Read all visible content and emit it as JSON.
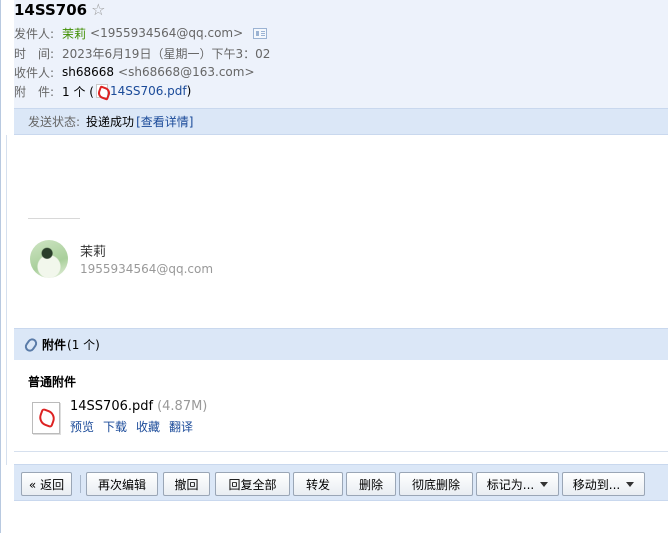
{
  "email": {
    "subject": "14SS706",
    "star": "☆",
    "from_label": "发件人:",
    "from_name": "茉莉",
    "from_addr": "<1955934564@qq.com>",
    "time_label": "时　间:",
    "time_value": "2023年6月19日（星期一）下午3：02",
    "to_label": "收件人:",
    "to_name": "sh68668",
    "to_addr": "<sh68668@163.com>",
    "attach_label": "附　件:",
    "attach_count": "1 个 (",
    "attach_file": "14SS706.pdf",
    "attach_close": ")",
    "status_label": "发送状态:",
    "status_value": "投递成功",
    "status_link": "[查看详情]"
  },
  "signature": {
    "name": "茉莉",
    "email": "1955934564@qq.com"
  },
  "attachments": {
    "title": "附件",
    "count": "(1 个)",
    "section": "普通附件",
    "file_name": "14SS706.pdf",
    "file_size": "(4.87M)",
    "actions": [
      "预览",
      "下载",
      "收藏",
      "翻译"
    ]
  },
  "toolbar": {
    "back": "« 返回",
    "re_edit": "再次编辑",
    "recall": "撤回",
    "reply_all": "回复全部",
    "forward": "转发",
    "delete": "删除",
    "perm_delete": "彻底删除",
    "mark_as": "标记为...",
    "move_to": "移动到..."
  }
}
